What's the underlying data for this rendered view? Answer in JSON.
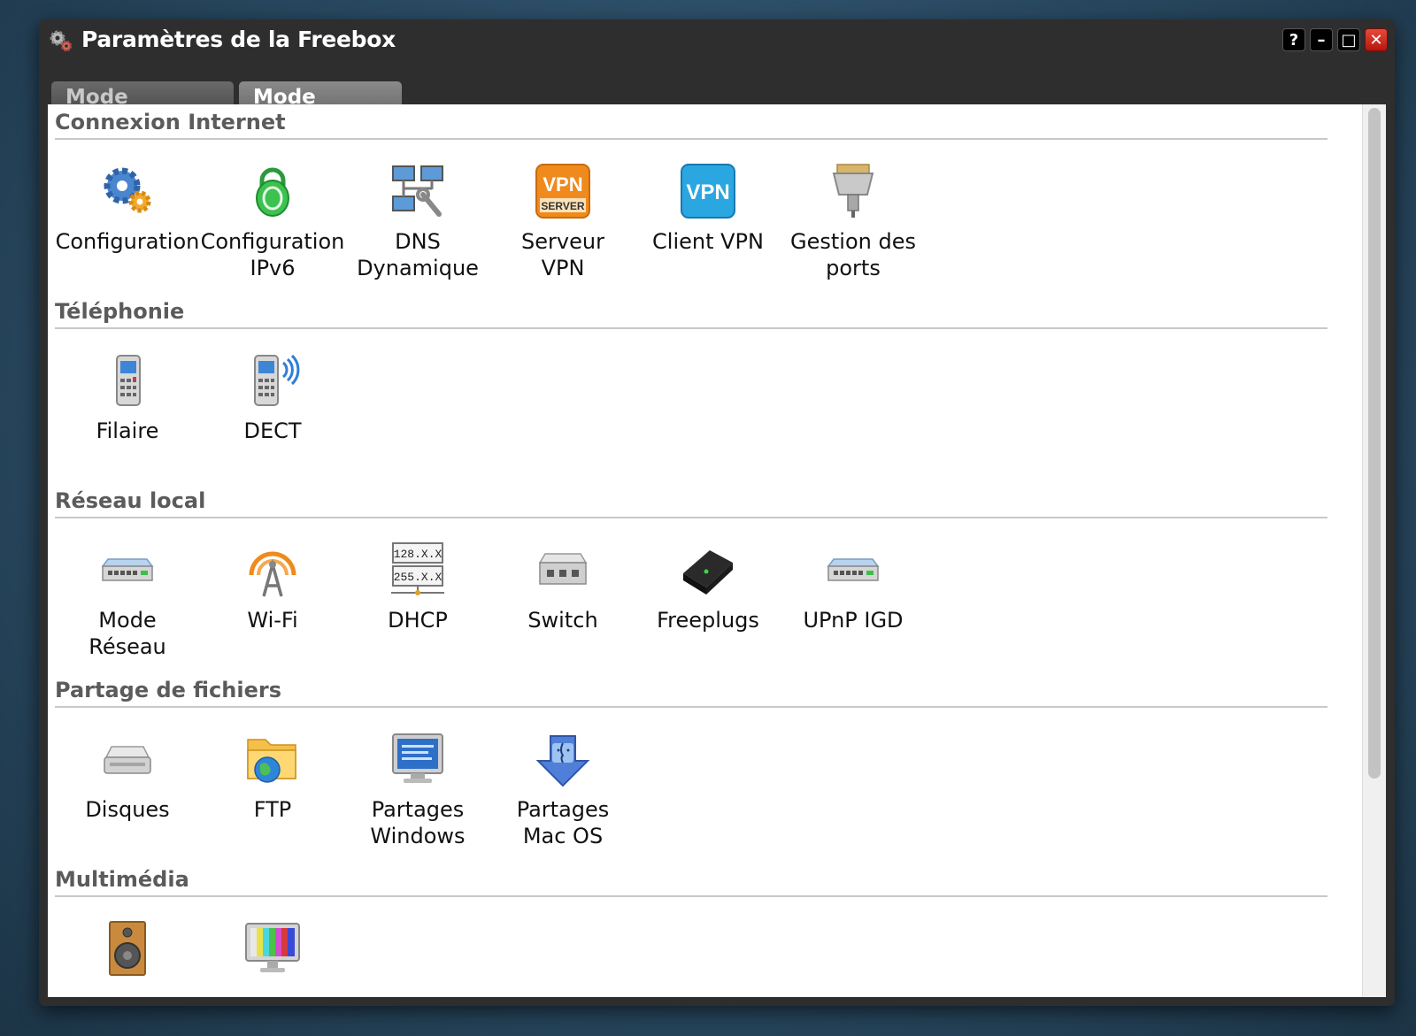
{
  "window": {
    "title": "Paramètres de la Freebox",
    "controls": [
      "?",
      "–",
      "□",
      "✕"
    ]
  },
  "tabs": [
    {
      "label": "Mode Simplifié",
      "active": false
    },
    {
      "label": "Mode avancé",
      "active": true
    }
  ],
  "sections": [
    {
      "title": "Connexion Internet",
      "items": [
        {
          "label": "Configuration",
          "icon": "gears-icon"
        },
        {
          "label": "Configuration\nIPv6",
          "icon": "lock-icon"
        },
        {
          "label": "DNS\nDynamique",
          "icon": "network-tools-icon"
        },
        {
          "label": "Serveur\nVPN",
          "icon": "vpn-server-icon",
          "badge": "VPN",
          "sub": "SERVER"
        },
        {
          "label": "Client VPN",
          "icon": "vpn-client-icon",
          "badge": "VPN"
        },
        {
          "label": "Gestion des\nports",
          "icon": "port-connector-icon"
        }
      ]
    },
    {
      "title": "Téléphonie",
      "items": [
        {
          "label": "Filaire",
          "icon": "phone-icon"
        },
        {
          "label": "DECT",
          "icon": "dect-phone-icon"
        }
      ]
    },
    {
      "title": "Réseau local",
      "items": [
        {
          "label": "Mode\nRéseau",
          "icon": "router-icon"
        },
        {
          "label": "Wi-Fi",
          "icon": "wifi-antenna-icon"
        },
        {
          "label": "DHCP",
          "icon": "dhcp-icon",
          "lines": [
            "128.X.X",
            "255.X.X"
          ]
        },
        {
          "label": "Switch",
          "icon": "switch-icon"
        },
        {
          "label": "Freeplugs",
          "icon": "freeplug-icon"
        },
        {
          "label": "UPnP IGD",
          "icon": "upnp-router-icon"
        }
      ]
    },
    {
      "title": "Partage de fichiers",
      "items": [
        {
          "label": "Disques",
          "icon": "disk-icon"
        },
        {
          "label": "FTP",
          "icon": "ftp-folder-icon"
        },
        {
          "label": "Partages\nWindows",
          "icon": "windows-share-icon"
        },
        {
          "label": "Partages\nMac OS",
          "icon": "mac-share-icon"
        }
      ]
    },
    {
      "title": "Multimédia",
      "items": [
        {
          "label": "",
          "icon": "speaker-icon"
        },
        {
          "label": "",
          "icon": "tv-icon"
        }
      ]
    }
  ],
  "colors": {
    "accent_orange": "#f08a1c",
    "accent_blue": "#2aa6e0",
    "close_red": "#d2301f"
  }
}
